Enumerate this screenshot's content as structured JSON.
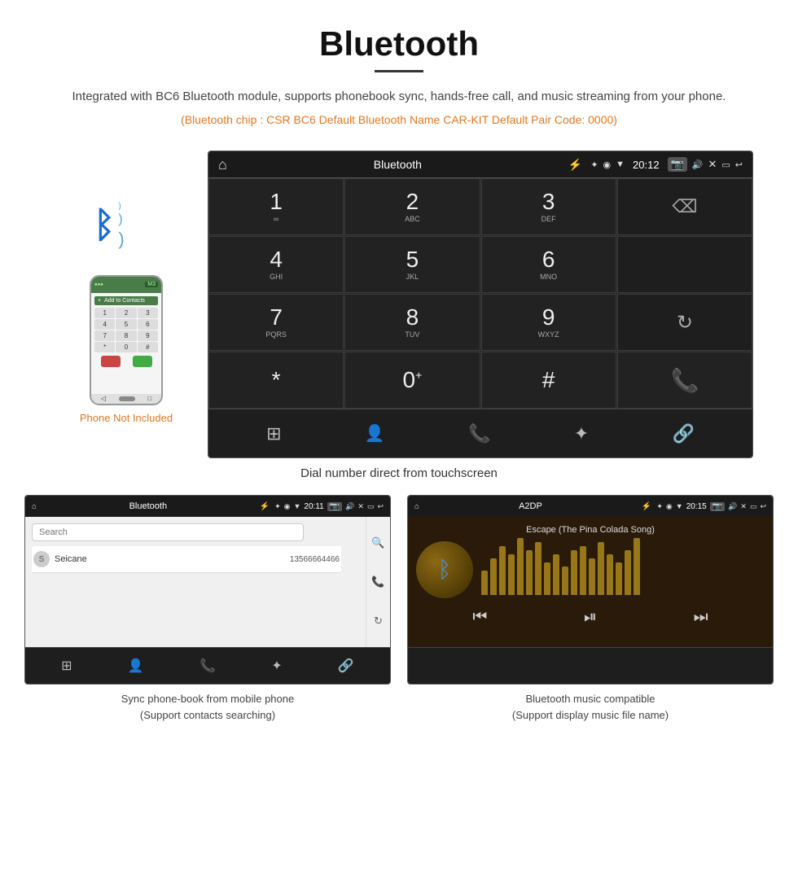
{
  "header": {
    "title": "Bluetooth",
    "description": "Integrated with BC6 Bluetooth module, supports phonebook sync, hands-free call, and music streaming from your phone.",
    "specs": "(Bluetooth chip : CSR BC6    Default Bluetooth Name CAR-KIT    Default Pair Code: 0000)"
  },
  "car_screen": {
    "status_bar": {
      "home": "⌂",
      "title": "Bluetooth",
      "usb_icon": "⚡",
      "bt_icon": "✦",
      "location": "◉",
      "signal": "▼",
      "time": "20:12",
      "camera": "📷",
      "volume": "🔊",
      "close": "✕",
      "window": "▭",
      "back": "↩"
    },
    "dialpad": {
      "keys": [
        {
          "num": "1",
          "sub": "∞",
          "col": 1
        },
        {
          "num": "2",
          "sub": "ABC",
          "col": 2
        },
        {
          "num": "3",
          "sub": "DEF",
          "col": 3
        },
        {
          "num": "4",
          "sub": "GHI",
          "col": 1
        },
        {
          "num": "5",
          "sub": "JKL",
          "col": 2
        },
        {
          "num": "6",
          "sub": "MNO",
          "col": 3
        },
        {
          "num": "7",
          "sub": "PQRS",
          "col": 1
        },
        {
          "num": "8",
          "sub": "TUV",
          "col": 2
        },
        {
          "num": "9",
          "sub": "WXYZ",
          "col": 3
        },
        {
          "num": "*",
          "sub": "",
          "col": 1
        },
        {
          "num": "0⁺",
          "sub": "",
          "col": 2
        },
        {
          "num": "#",
          "sub": "",
          "col": 3
        }
      ]
    },
    "bottom_nav_icons": [
      "⊞",
      "👤",
      "📞",
      "✦",
      "🔗"
    ]
  },
  "phone_aside": {
    "not_included": "Phone Not Included"
  },
  "main_caption": "Dial number direct from touchscreen",
  "phonebook_screen": {
    "title": "Bluetooth",
    "time": "20:11",
    "search_placeholder": "Search",
    "contacts": [
      {
        "initial": "S",
        "name": "Seicane",
        "phone": "13566664466"
      }
    ]
  },
  "music_screen": {
    "title": "A2DP",
    "time": "20:15",
    "track": "Escape (The Pina Colada Song)",
    "eq_bars": [
      30,
      45,
      60,
      50,
      70,
      55,
      65,
      40,
      50,
      35,
      55,
      60,
      45,
      65,
      50,
      40,
      55,
      70
    ]
  },
  "captions": {
    "phonebook": "Sync phone-book from mobile phone\n(Support contacts searching)",
    "music": "Bluetooth music compatible\n(Support display music file name)"
  }
}
